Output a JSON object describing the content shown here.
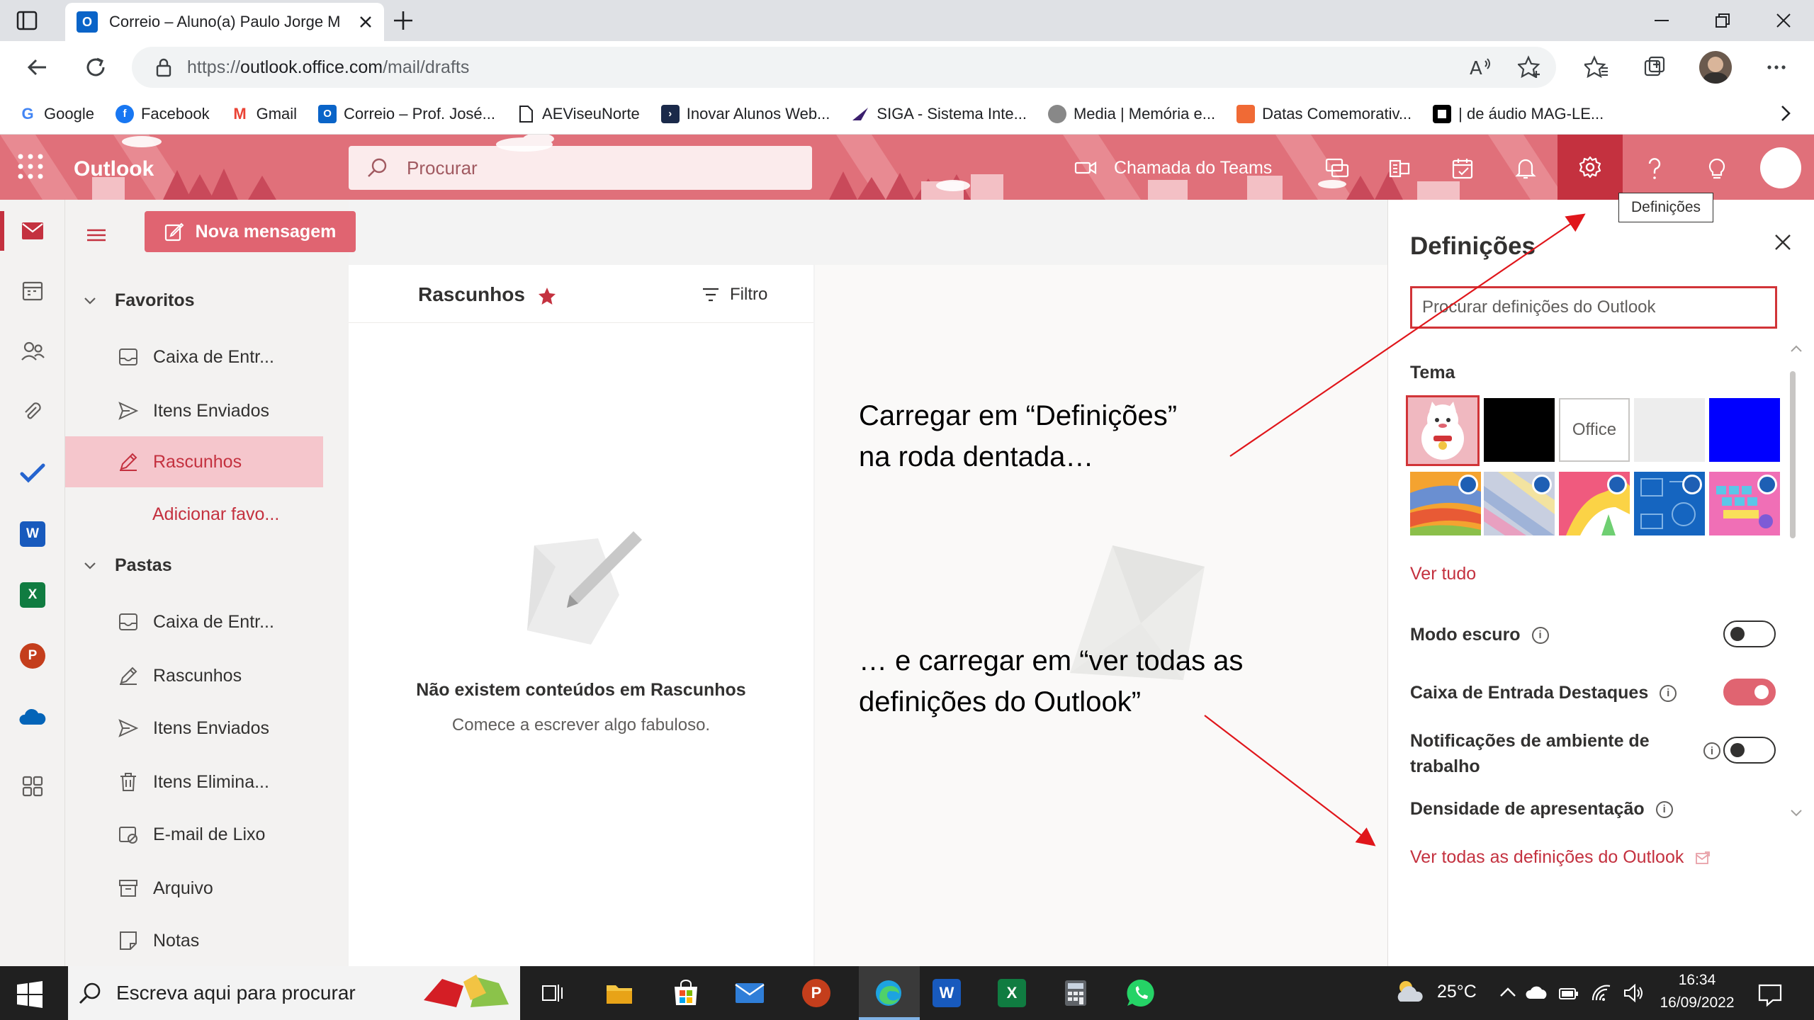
{
  "browser": {
    "tab_title": "Correio – Aluno(a) Paulo Jorge M",
    "url_prefix": "https://",
    "url_main": "outlook.office.com",
    "url_suffix": "/mail/drafts",
    "favorites": [
      {
        "label": "Google",
        "color": "#ffffff"
      },
      {
        "label": "Facebook",
        "color": "#1877f2"
      },
      {
        "label": "Gmail",
        "color": "#ffffff"
      },
      {
        "label": "Correio – Prof. José...",
        "color": "#0a64c8"
      },
      {
        "label": "AEViseuNorte",
        "color": "#ffffff"
      },
      {
        "label": "Inovar Alunos Web...",
        "color": "#1b2a4a"
      },
      {
        "label": "SIGA - Sistema Inte...",
        "color": "#ffffff"
      },
      {
        "label": "Media | Memória e...",
        "color": "#888888"
      },
      {
        "label": "Datas Comemorativ...",
        "color": "#f06a35"
      },
      {
        "label": "| de áudio MAG-LE...",
        "color": "#000000"
      }
    ]
  },
  "outlook": {
    "brand": "Outlook",
    "search_placeholder": "Procurar",
    "teams_label": "Chamada do Teams",
    "new_message": "Nova mensagem",
    "favorites_group": "Favoritos",
    "favorites_items": [
      "Caixa de Entr...",
      "Itens Enviados",
      "Rascunhos"
    ],
    "add_favorite": "Adicionar favo...",
    "folders_group": "Pastas",
    "folder_items": [
      "Caixa de Entr...",
      "Rascunhos",
      "Itens Enviados",
      "Itens Elimina...",
      "E-mail de Lixo",
      "Arquivo",
      "Notas"
    ],
    "list_title": "Rascunhos",
    "filter": "Filtro",
    "empty_title": "Não existem conteúdos em Rascunhos",
    "empty_subtitle": "Comece a escrever algo fabuloso."
  },
  "tooltip": "Definições",
  "settings": {
    "title": "Definições",
    "search_placeholder": "Procurar definições do Outlook",
    "theme_label": "Tema",
    "office_theme": "Office",
    "see_all_themes": "Ver tudo",
    "dark_mode": "Modo escuro",
    "focused_inbox": "Caixa de Entrada Destaques",
    "desktop_notifications_line1": "Notificações de ambiente de",
    "desktop_notifications_line2": "trabalho",
    "density": "Densidade de apresentação",
    "view_all": "Ver todas as definições do Outlook",
    "toggles": {
      "dark_mode": false,
      "focused_inbox": true,
      "desktop_notifications": false
    }
  },
  "annotations": {
    "note1_line1": "Carregar em “Definições”",
    "note1_line2": "na roda dentada…",
    "note2_line1": "… e carregar em “ver todas as",
    "note2_line2": "definições do Outlook”"
  },
  "taskbar": {
    "search": "Escreva aqui para procurar",
    "temperature": "25°C",
    "time": "16:34",
    "date": "16/09/2022"
  },
  "colors": {
    "accent": "#c4313f",
    "header": "#e0707a",
    "button": "#e06471"
  }
}
